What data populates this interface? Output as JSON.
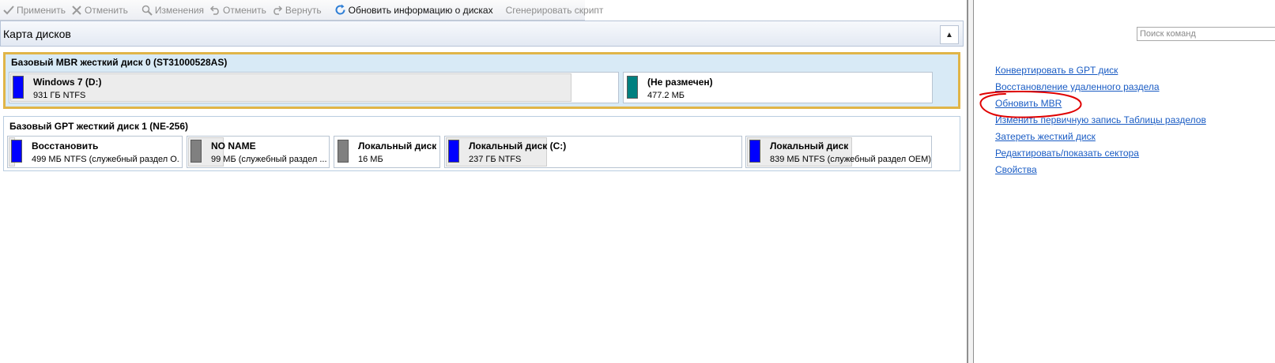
{
  "toolbar": {
    "apply": "Применить",
    "cancel": "Отменить",
    "changes": "Изменения",
    "undo": "Отменить",
    "redo": "Вернуть",
    "refresh": "Обновить информацию о дисках",
    "generate": "Сгенерировать скрипт"
  },
  "disk_map": {
    "title": "Карта дисков",
    "disks": [
      {
        "title": "Базовый MBR жесткий диск 0 (ST31000528AS)",
        "partitions": [
          {
            "name": "Windows 7 (D:)",
            "info": "931 ГБ NTFS",
            "color": "#0000ff"
          },
          {
            "name": "(Не размечен)",
            "info": "477.2 МБ",
            "color": "#008080"
          }
        ]
      },
      {
        "title": "Базовый GPT жесткий диск 1 (NE-256)",
        "partitions": [
          {
            "name": "Восстановить",
            "info": "499 МБ NTFS (служебный раздел О...",
            "color": "#0000ff"
          },
          {
            "name": "NO NAME",
            "info": "99 МБ  (служебный раздел ...",
            "color": "#808080"
          },
          {
            "name": "Локальный диск",
            "info": "16 МБ",
            "color": "#808080"
          },
          {
            "name": "Локальный диск (C:)",
            "info": "237 ГБ NTFS",
            "color": "#0000ff"
          },
          {
            "name": "Локальный диск",
            "info": "839 МБ NTFS (служебный раздел OEM)",
            "color": "#0000ff"
          }
        ]
      }
    ]
  },
  "commands": {
    "search_placeholder": "Поиск команд",
    "items": [
      "Конвертировать в GPT диск",
      "Восстановление удаленного раздела",
      "Обновить MBR",
      "Изменить первичную запись Таблицы разделов",
      "Затереть жесткий диск",
      "Редактировать/показать сектора",
      "Свойства"
    ]
  },
  "colors": {
    "accent_link": "#1a5cc4",
    "selection_border": "#e0b548",
    "annotation": "#e00000"
  }
}
